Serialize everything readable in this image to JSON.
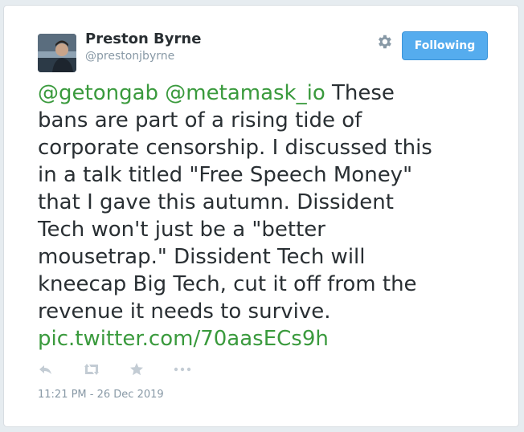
{
  "user": {
    "name": "Preston Byrne",
    "handle": "@prestonjbyrne"
  },
  "follow_button": {
    "label": "Following",
    "color": "#55acee"
  },
  "tweet": {
    "lines": [
      [
        {
          "text": "@getongab",
          "link": true
        },
        {
          "text": " "
        },
        {
          "text": "@metamask_io",
          "link": true
        },
        {
          "text": " These"
        }
      ],
      [
        {
          "text": "bans are part of a rising tide of"
        }
      ],
      [
        {
          "text": "corporate censorship. I discussed this"
        }
      ],
      [
        {
          "text": "in a talk titled \"Free Speech Money\""
        }
      ],
      [
        {
          "text": "that I gave this autumn. Dissident"
        }
      ],
      [
        {
          "text": "Tech won't just be a \"better"
        }
      ],
      [
        {
          "text": "mousetrap.\" Dissident Tech will"
        }
      ],
      [
        {
          "text": "kneecap Big Tech, cut it off from the"
        }
      ],
      [
        {
          "text": "revenue it needs to survive."
        }
      ],
      [
        {
          "text": "pic.twitter.com/70aasECs9h",
          "link": true
        }
      ]
    ],
    "link_color": "#3a9a3d"
  },
  "actions": {
    "icons": [
      "reply-icon",
      "retweet-icon",
      "favorite-icon",
      "more-icon"
    ]
  },
  "timestamp": "11:21 PM - 26 Dec 2019"
}
